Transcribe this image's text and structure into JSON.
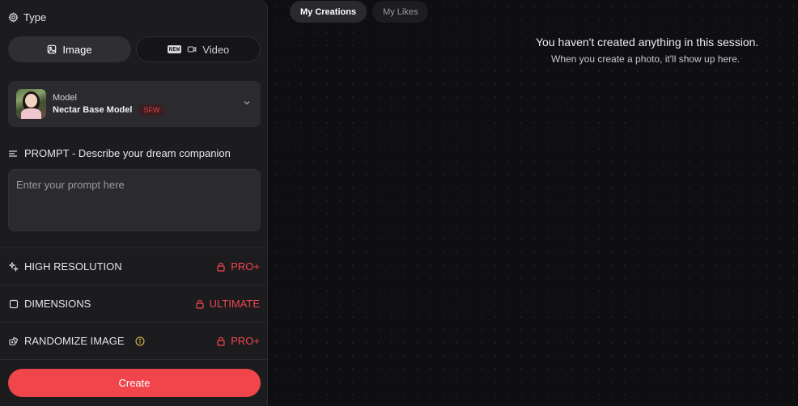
{
  "type_section": {
    "label": "Type",
    "icon": "gear-icon"
  },
  "type_toggle": {
    "image_label": "Image",
    "video_label": "Video",
    "video_badge": "NEW",
    "selected": "Image"
  },
  "model": {
    "label": "Model",
    "name": "Nectar Base Model",
    "badge": "SFW"
  },
  "prompt": {
    "label": "PROMPT - Describe your dream companion",
    "placeholder": "Enter your prompt here",
    "value": ""
  },
  "options": [
    {
      "label": "HIGH RESOLUTION",
      "lock_label": "PRO+",
      "icon": "sparkles-icon"
    },
    {
      "label": "DIMENSIONS",
      "lock_label": "ULTIMATE",
      "icon": "square-icon"
    },
    {
      "label": "RANDOMIZE IMAGE",
      "lock_label": "PRO+",
      "icon": "dice-icon",
      "has_info": true
    }
  ],
  "create_label": "Create",
  "tabs": [
    {
      "label": "My Creations",
      "active": true
    },
    {
      "label": "My Likes",
      "active": false
    }
  ],
  "empty_state": {
    "title": "You haven't created anything in this session.",
    "subtitle": "When you create a photo, it'll show up here."
  },
  "colors": {
    "accent": "#f0454b",
    "panel_bg": "#1c1c1f",
    "page_bg": "#0f0f11"
  }
}
